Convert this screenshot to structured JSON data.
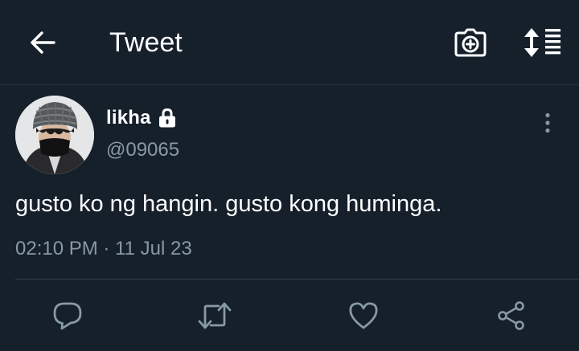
{
  "header": {
    "title": "Tweet",
    "back_icon": "arrow-left-icon",
    "camera_icon": "camera-plus-icon",
    "sort_icon": "sort-lines-icon"
  },
  "tweet": {
    "author": {
      "name": "likha",
      "handle": "@09065",
      "protected_icon": "lock-icon"
    },
    "text": "gusto ko ng hangin. gusto kong huminga.",
    "meta": "02:10 PM · 11 Jul 23"
  },
  "actions": {
    "reply_icon": "reply-icon",
    "retweet_icon": "retweet-icon",
    "like_icon": "heart-icon",
    "share_icon": "share-icon"
  },
  "colors": {
    "background": "#15202b",
    "primary_text": "#ffffff",
    "secondary_text": "#8899a6",
    "icon": "#8899a6",
    "divider": "#2f3d4b"
  }
}
